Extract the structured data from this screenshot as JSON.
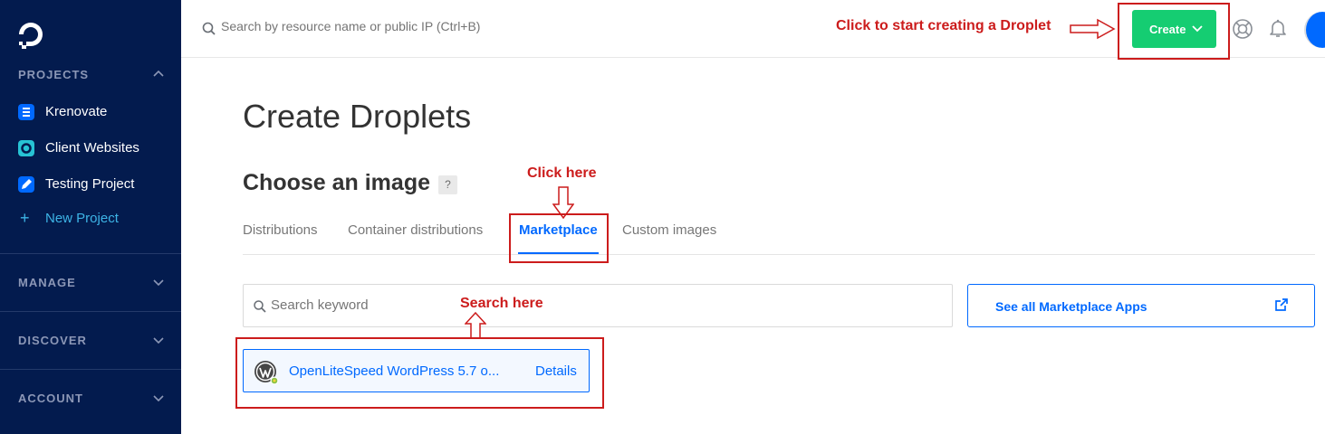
{
  "sidebar": {
    "projects_heading": "PROJECTS",
    "projects": [
      {
        "label": "Krenovate",
        "icon": "list-project-icon",
        "color": "#0069ff"
      },
      {
        "label": "Client Websites",
        "icon": "circle-project-icon",
        "color": "#27c3d4"
      },
      {
        "label": "Testing Project",
        "icon": "pencil-project-icon",
        "color": "#0069ff"
      }
    ],
    "new_project_label": "New Project",
    "sections": [
      "MANAGE",
      "DISCOVER",
      "ACCOUNT"
    ]
  },
  "topbar": {
    "search_placeholder": "Search by resource name or public IP (Ctrl+B)",
    "create_label": "Create"
  },
  "annotations": {
    "create": "Click to start creating a Droplet",
    "click_here": "Click here",
    "search_here": "Search here"
  },
  "main": {
    "title": "Create Droplets",
    "section_title": "Choose an image",
    "help_badge": "?",
    "tabs": [
      {
        "label": "Distributions",
        "active": false
      },
      {
        "label": "Container distributions",
        "active": false
      },
      {
        "label": "Marketplace",
        "active": true
      },
      {
        "label": "Custom images",
        "active": false
      }
    ],
    "keyword_placeholder": "Search keyword",
    "see_all_label": "See all Marketplace Apps",
    "result": {
      "name": "OpenLiteSpeed WordPress 5.7 o...",
      "details_label": "Details"
    }
  },
  "colors": {
    "sidebar_bg": "#031b4e",
    "accent": "#0069ff",
    "create_green": "#15cd72",
    "annotation_red": "#cc1c1c"
  }
}
